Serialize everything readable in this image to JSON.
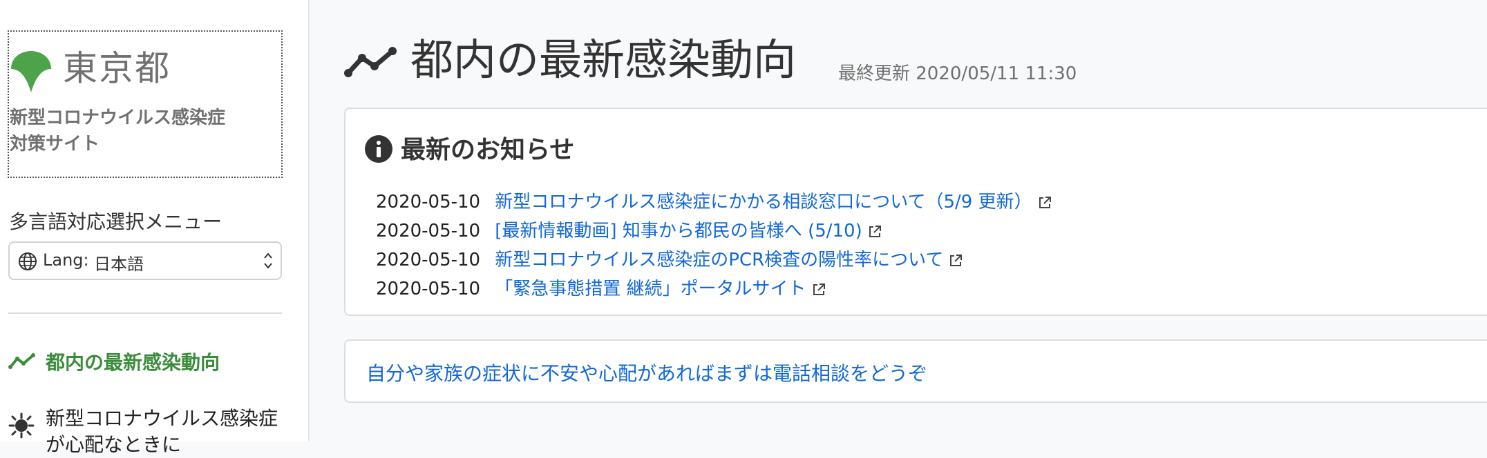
{
  "sidebar": {
    "logo_text": "東京都",
    "site_title_line1": "新型コロナウイルス感染症",
    "site_title_line2": "対策サイト",
    "lang_menu_label": "多言語対応選択メニュー",
    "lang_select": {
      "prefix": "Lang:",
      "value": "日本語"
    },
    "nav": [
      {
        "label": "都内の最新感染動向",
        "icon": "trend-chart-icon"
      },
      {
        "label_line1": "新型コロナウイルス感染症",
        "label_line2": "が心配なときに",
        "icon": "virus-icon"
      }
    ]
  },
  "header": {
    "title": "都内の最新感染動向",
    "last_updated": "最終更新 2020/05/11 11:30"
  },
  "news": {
    "title": "最新のお知らせ",
    "items": [
      {
        "date": "2020-05-10",
        "text": "新型コロナウイルス感染症にかかる相談窓口について（5/9 更新）"
      },
      {
        "date": "2020-05-10",
        "text": "[最新情報動画] 知事から都民の皆様へ (5/10)"
      },
      {
        "date": "2020-05-10",
        "text": "新型コロナウイルス感染症のPCR検査の陽性率について"
      },
      {
        "date": "2020-05-10",
        "text": "「緊急事態措置 継続」ポータルサイト"
      }
    ]
  },
  "consult": {
    "text": "自分や家族の症状に不安や心配があればまずは電話相談をどうぞ"
  },
  "colors": {
    "brand_green": "#3a8c3a",
    "logo_green": "#4ca34a",
    "link_blue": "#1268d8",
    "text_dark": "#333333",
    "text_gray": "#707070"
  }
}
